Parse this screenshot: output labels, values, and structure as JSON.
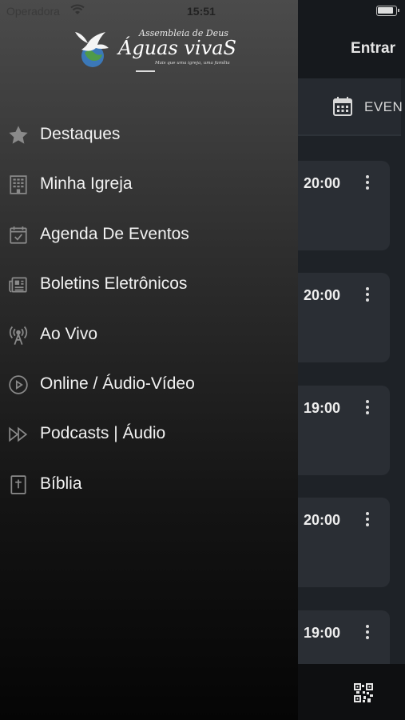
{
  "status_bar": {
    "carrier": "Operadora",
    "time": "15:51"
  },
  "header": {
    "login_label": "Entrar"
  },
  "tabs": {
    "events_label": "EVEN"
  },
  "events": [
    {
      "time": "20:00"
    },
    {
      "time": "20:00"
    },
    {
      "time": "19:00"
    },
    {
      "time": "20:00"
    },
    {
      "time": "19:00"
    }
  ],
  "logo": {
    "line1": "Assembleia de Deus",
    "line2": "Águas vivaS",
    "tagline": "Mais que uma igreja, uma família"
  },
  "menu": {
    "items": [
      {
        "label": "Destaques",
        "icon": "star-icon"
      },
      {
        "label": "Minha Igreja",
        "icon": "building-icon"
      },
      {
        "label": "Agenda De Eventos",
        "icon": "calendar-check-icon"
      },
      {
        "label": "Boletins Eletrônicos",
        "icon": "newspaper-icon"
      },
      {
        "label": "Ao Vivo",
        "icon": "broadcast-icon"
      },
      {
        "label": "Online / Áudio-Vídeo",
        "icon": "play-circle-icon"
      },
      {
        "label": "Podcasts | Áudio",
        "icon": "fast-forward-icon"
      },
      {
        "label": "Bíblia",
        "icon": "bible-icon"
      }
    ]
  },
  "colors": {
    "drawer_top": "#4b4b4b",
    "drawer_bottom": "#050505",
    "app_bg": "#1e2227",
    "card_bg": "#2a2e34"
  }
}
